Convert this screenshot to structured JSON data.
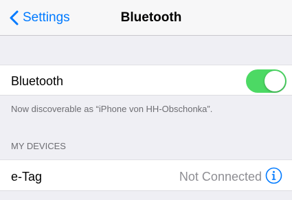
{
  "navbar": {
    "back_label": "Settings",
    "title": "Bluetooth"
  },
  "bluetooth_cell": {
    "label": "Bluetooth",
    "toggle_on": true
  },
  "discoverable_text": "Now discoverable as “iPhone von HH-Obschonka”.",
  "my_devices": {
    "header": "MY DEVICES",
    "devices": [
      {
        "name": "e-Tag",
        "status": "Not Connected"
      }
    ]
  },
  "colors": {
    "accent": "#007aff",
    "toggle_on": "#4cd964",
    "secondary_text": "#6d6d72",
    "status_text": "#8e8e93",
    "background": "#efeff4"
  },
  "icons": {
    "back": "chevron-left-icon",
    "info": "info-circle-icon"
  }
}
